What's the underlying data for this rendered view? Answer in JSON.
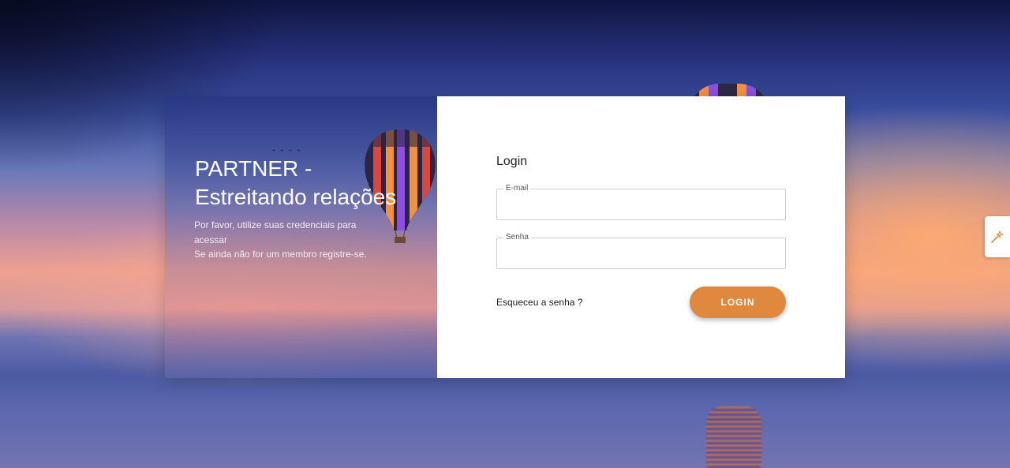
{
  "brand": {
    "title_line1": "PARTNER -",
    "title_line2": "Estreitando relações",
    "subtitle_line1": "Por favor, utilize suas credenciais para acessar",
    "subtitle_line2": "Se ainda não for um membro registre-se."
  },
  "login": {
    "title": "Login",
    "email": {
      "label": "E-mail",
      "value": ""
    },
    "password": {
      "label": "Senha",
      "value": ""
    },
    "forgot_label": "Esqueceu a senha ?",
    "button_label": "LOGIN"
  },
  "side_tab": {
    "icon": "magic-wand-icon"
  },
  "colors": {
    "accent": "#e1883f",
    "panel_bg": "#ffffff"
  }
}
